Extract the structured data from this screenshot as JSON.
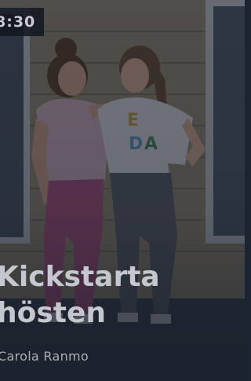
{
  "card": {
    "time": "8:30",
    "title_line1": "Kickstarta",
    "title_line2": "hösten",
    "author": "Carola Ranmo",
    "shirt_letters": [
      "E",
      "D",
      "A"
    ]
  },
  "colors": {
    "overlay": "#141a26",
    "wall": "#a89a7c",
    "window_frame": "#cfd3d6",
    "pants_pink": "#b4507e",
    "pants_grey": "#5a5e66",
    "shirt_white": "#e6e6e8",
    "shirt_pink": "#d9b5c4"
  }
}
